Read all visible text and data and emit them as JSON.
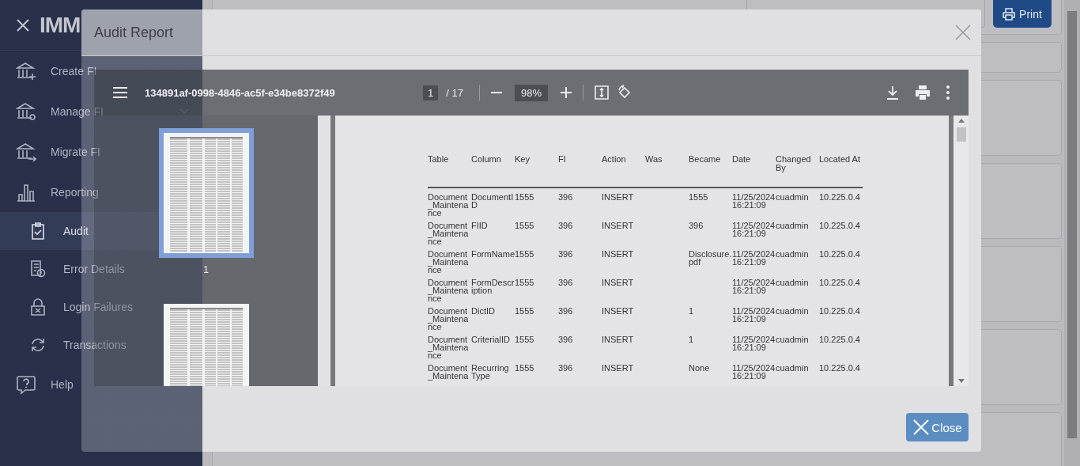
{
  "sidebar": {
    "logo": "IMM",
    "items": [
      {
        "label": "Create FI",
        "has_submenu": false,
        "selected": false
      },
      {
        "label": "Manage FI",
        "has_submenu": true,
        "selected": false
      },
      {
        "label": "Migrate FI",
        "selected": false
      },
      {
        "label": "Reporting",
        "selected": false,
        "children": [
          {
            "label": "Audit",
            "selected": true
          },
          {
            "label": "Error Details",
            "selected": false
          },
          {
            "label": "Login Failures",
            "selected": false
          },
          {
            "label": "Transactions",
            "selected": false
          }
        ]
      },
      {
        "label": "Help",
        "selected": false
      }
    ]
  },
  "print_button": "Print",
  "modal": {
    "title": "Audit Report",
    "pdf_viewer": {
      "file_name": "134891af-0998-4846-ac5f-e34be8372f49",
      "page": "1",
      "page_count": "/ 17",
      "zoom": "98%",
      "thumbnails": [
        {
          "label": "1",
          "selected": true
        },
        {
          "selected": false
        }
      ],
      "table": {
        "columns": [
          "Table",
          "Column",
          "Key",
          "FI",
          "Action",
          "Was",
          "Became",
          "Date",
          "Changed By",
          "Located At"
        ],
        "rows": [
          [
            "Document_Maintenance",
            "DocumentID",
            "1555",
            "396",
            "INSERT",
            null,
            "1555",
            "11/25/2024 16:21:09",
            "cuadmin",
            "10.225.0.4"
          ],
          [
            "Document_Maintenance",
            "FIID",
            "1555",
            "396",
            "INSERT",
            null,
            "396",
            "11/25/2024 16:21:09",
            "cuadmin",
            "10.225.0.4"
          ],
          [
            "Document_Maintenance",
            "FormName",
            "1555",
            "396",
            "INSERT",
            null,
            "Disclosure.pdf",
            "11/25/2024 16:21:09",
            "cuadmin",
            "10.225.0.4"
          ],
          [
            "Document_Maintenance",
            "FormDescription",
            "1555",
            "396",
            "INSERT",
            null,
            null,
            "11/25/2024 16:21:09",
            "cuadmin",
            "10.225.0.4"
          ],
          [
            "Document_Maintenance",
            "DictID",
            "1555",
            "396",
            "INSERT",
            null,
            "1",
            "11/25/2024 16:21:09",
            "cuadmin",
            "10.225.0.4"
          ],
          [
            "Document_Maintenance",
            "CriterialID",
            "1555",
            "396",
            "INSERT",
            null,
            "1",
            "11/25/2024 16:21:09",
            "cuadmin",
            "10.225.0.4"
          ],
          [
            "Document_Maintena",
            "Recurring Type",
            "1555",
            "396",
            "INSERT",
            null,
            "None",
            "11/25/2024 16:21:09",
            "cuadmin",
            "10.225.0.4"
          ]
        ]
      }
    },
    "close_button": "Close"
  }
}
